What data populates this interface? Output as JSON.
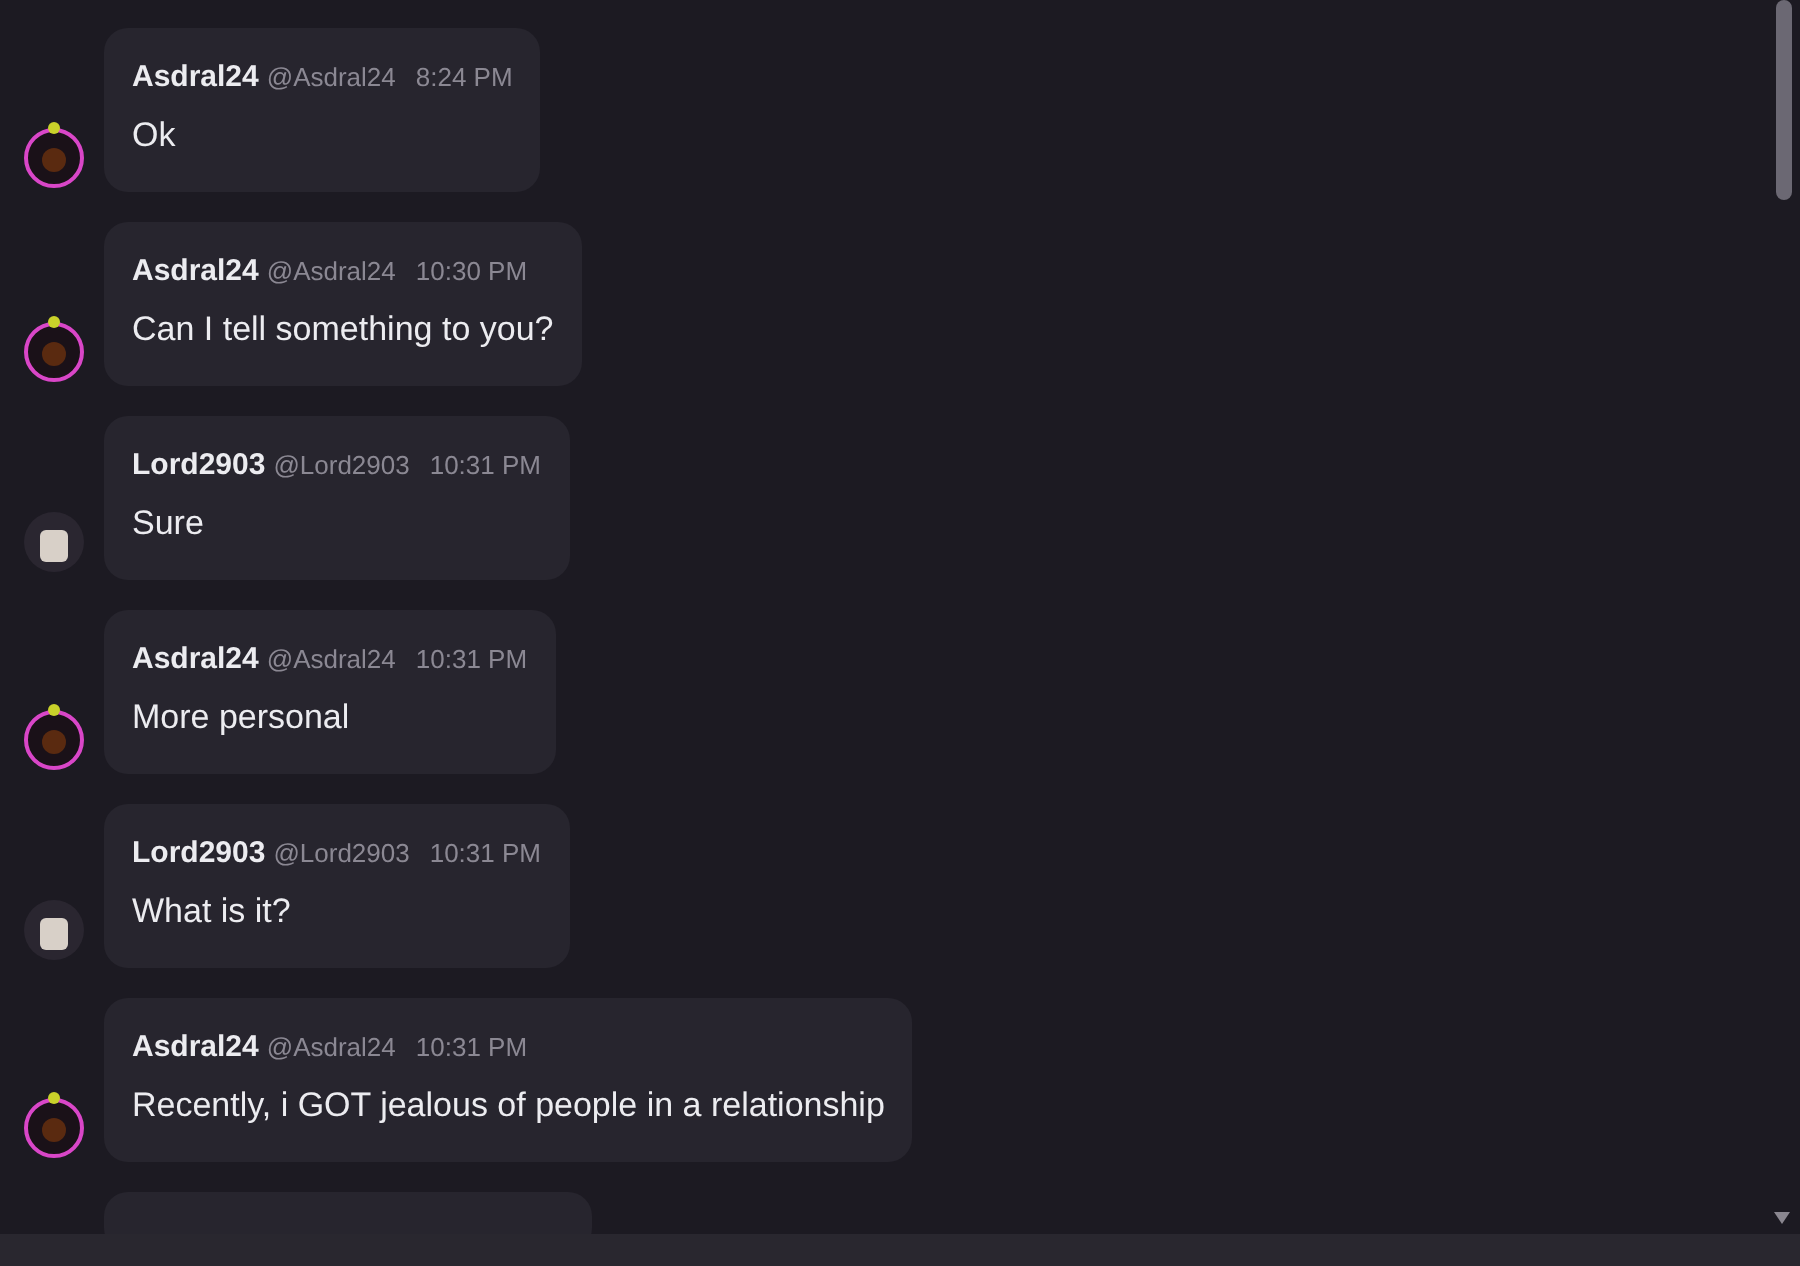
{
  "messages": [
    {
      "kind": "ring",
      "name": "Asdral24",
      "handle": "@Asdral24",
      "time": "8:24 PM",
      "text": "Ok"
    },
    {
      "kind": "ring",
      "name": "Asdral24",
      "handle": "@Asdral24",
      "time": "10:30 PM",
      "text": "Can I tell something to you?"
    },
    {
      "kind": "dark",
      "name": "Lord2903",
      "handle": "@Lord2903",
      "time": "10:31 PM",
      "text": "Sure"
    },
    {
      "kind": "ring",
      "name": "Asdral24",
      "handle": "@Asdral24",
      "time": "10:31 PM",
      "text": "More personal"
    },
    {
      "kind": "dark",
      "name": "Lord2903",
      "handle": "@Lord2903",
      "time": "10:31 PM",
      "text": "What is it?"
    },
    {
      "kind": "ring",
      "name": "Asdral24",
      "handle": "@Asdral24",
      "time": "10:31 PM",
      "text": "Recently, i GOT jealous of people in a relationship"
    }
  ]
}
